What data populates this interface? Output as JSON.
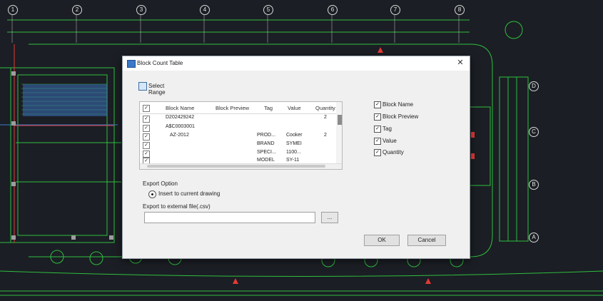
{
  "drawing": {
    "grid_bubbles": [
      "1",
      "2",
      "3",
      "4",
      "5",
      "6",
      "7",
      "8"
    ],
    "side_bubbles": [
      "D",
      "C",
      "B",
      "A"
    ],
    "colors": {
      "background": "#1b1e24",
      "walls": "#2fbf3f",
      "accent": "#e53935",
      "text": "#e6e6e6"
    }
  },
  "dialog": {
    "title": "Block Count Table",
    "close_icon": "close-icon",
    "select_range_label": "Select Range",
    "table": {
      "headers": [
        "Block Name",
        "Block Preview",
        "Tag",
        "Value",
        "Quantity"
      ],
      "rows": [
        {
          "checked": true,
          "name": "D202429242",
          "tag": "",
          "value": "",
          "quantity": "2"
        },
        {
          "checked": true,
          "name": "A$C0003001",
          "tag": "",
          "value": "",
          "quantity": ""
        },
        {
          "checked": true,
          "name": "AZ-2012",
          "tag": "PROD...",
          "value": "Cooker",
          "quantity": "2"
        },
        {
          "checked": true,
          "name": "",
          "tag": "BRAND",
          "value": "SYMEI",
          "quantity": ""
        },
        {
          "checked": true,
          "name": "",
          "tag": "SPECI...",
          "value": "1100...",
          "quantity": ""
        },
        {
          "checked": true,
          "name": "",
          "tag": "MODEL",
          "value": "SY-11",
          "quantity": ""
        }
      ]
    },
    "column_options": [
      {
        "label": "Block Name",
        "checked": true
      },
      {
        "label": "Block Preview",
        "checked": true
      },
      {
        "label": "Tag",
        "checked": true
      },
      {
        "label": "Value",
        "checked": true
      },
      {
        "label": "Quantity",
        "checked": true
      }
    ],
    "export": {
      "title": "Export Option",
      "insert_label": "Insert to current drawing",
      "external_label": "Export to external file(.csv)",
      "path_value": "",
      "browse_label": "..."
    },
    "ok_label": "OK",
    "cancel_label": "Cancel"
  }
}
